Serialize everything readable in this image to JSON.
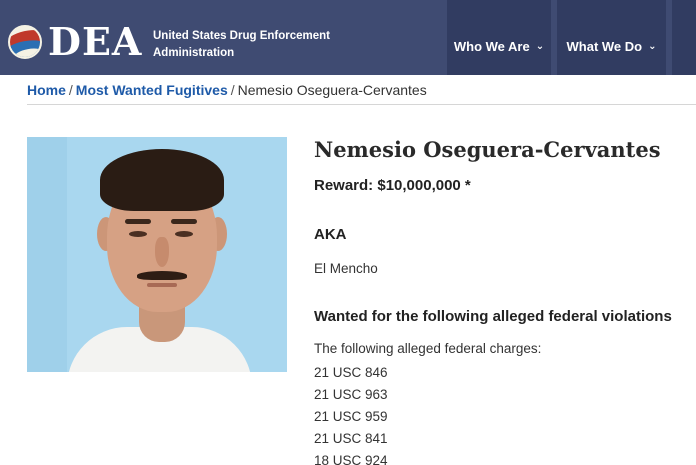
{
  "header": {
    "logo_text": "DEA",
    "agency_line1": "United States Drug Enforcement",
    "agency_line2": "Administration",
    "nav": [
      {
        "label": "Who We Are",
        "icon": "chevron-down-icon"
      },
      {
        "label": "What We Do",
        "icon": "chevron-down-icon"
      }
    ]
  },
  "breadcrumb": {
    "home": "Home",
    "most_wanted": "Most Wanted Fugitives",
    "current": "Nemesio Oseguera-Cervantes",
    "separator": "/"
  },
  "profile": {
    "name": "Nemesio Oseguera-Cervantes",
    "reward": "Reward: $10,000,000 *",
    "aka_heading": "AKA",
    "aka_value": "El Mencho",
    "violations_heading": "Wanted for the following alleged federal violations",
    "charges_intro": "The following alleged federal charges:",
    "charges": [
      "21 USC 846",
      "21 USC 963",
      "21 USC 959",
      "21 USC 841",
      "18 USC 924"
    ]
  },
  "colors": {
    "header_bg": "#3f4b72",
    "nav_bg": "#313c61",
    "link": "#1e5aa8"
  }
}
